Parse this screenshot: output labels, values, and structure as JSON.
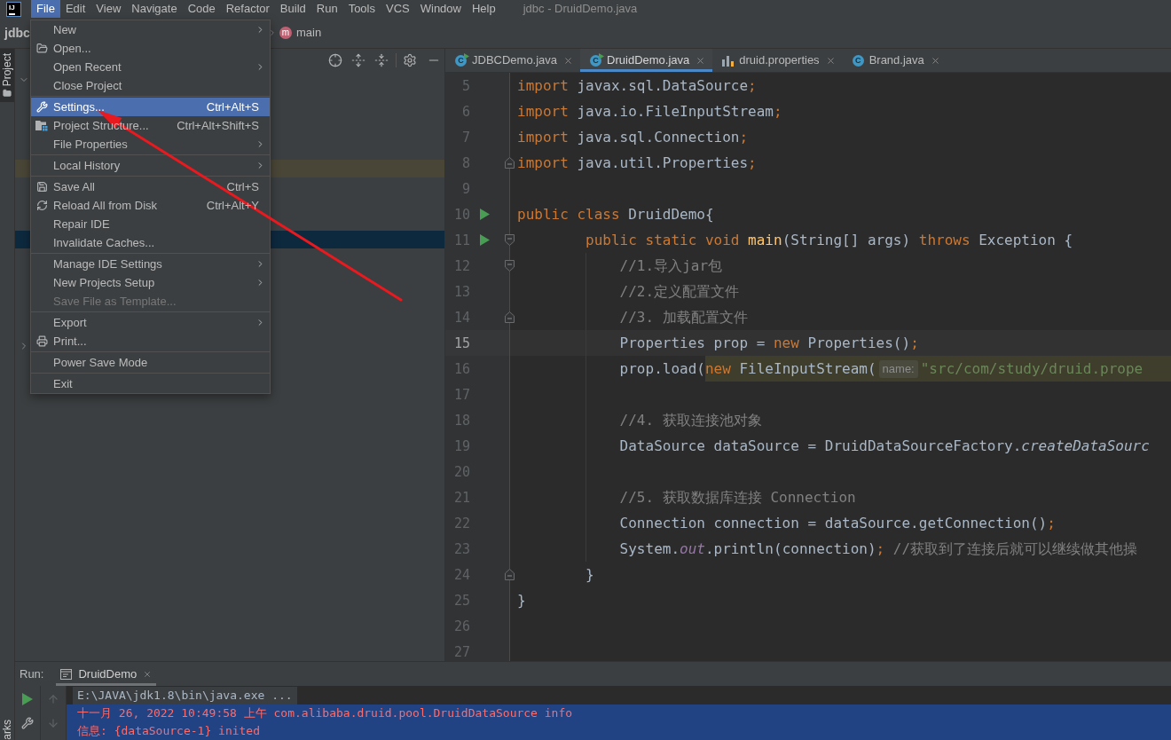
{
  "menubar": {
    "logo": "IJ",
    "items": [
      {
        "label": "File",
        "selected": true
      },
      {
        "label": "Edit",
        "selected": false
      },
      {
        "label": "View",
        "selected": false
      },
      {
        "label": "Navigate",
        "selected": false
      },
      {
        "label": "Code",
        "selected": false
      },
      {
        "label": "Refactor",
        "selected": false
      },
      {
        "label": "Build",
        "selected": false
      },
      {
        "label": "Run",
        "selected": false
      },
      {
        "label": "Tools",
        "selected": false
      },
      {
        "label": "VCS",
        "selected": false
      },
      {
        "label": "Window",
        "selected": false
      },
      {
        "label": "Help",
        "selected": false
      }
    ],
    "title": "jdbc - DruidDemo.java"
  },
  "navbar": {
    "crumbs": [
      {
        "label": "jdbc",
        "kind": "project"
      },
      {
        "label": "main",
        "kind": "method",
        "badge": "m"
      }
    ]
  },
  "tool_stripe": {
    "top": [
      {
        "label": "Project",
        "selected": true
      }
    ],
    "bottom": [
      {
        "label": "arks",
        "selected": false
      }
    ]
  },
  "project_panel": {
    "tree": [
      {
        "expanded": true,
        "selected": false,
        "highlighted": false,
        "children": [
          {
            "selected": false,
            "highlighted": false
          },
          {
            "selected": false,
            "highlighted": false
          },
          {
            "selected": false,
            "highlighted": false
          },
          {
            "selected": false,
            "highlighted": false
          },
          {
            "selected": false,
            "highlighted": true
          },
          {
            "selected": false,
            "highlighted": false
          },
          {
            "selected": false,
            "highlighted": false
          },
          {
            "selected": false,
            "highlighted": false
          },
          {
            "selected": true,
            "highlighted": false
          },
          {
            "selected": false,
            "highlighted": false
          },
          {
            "selected": false,
            "highlighted": false
          },
          {
            "selected": false,
            "highlighted": false
          },
          {
            "selected": false,
            "highlighted": false
          },
          {
            "selected": false,
            "highlighted": false
          }
        ]
      },
      {
        "expanded": false,
        "selected": false,
        "highlighted": false
      }
    ]
  },
  "file_menu": {
    "items": [
      {
        "kind": "item",
        "label": "New",
        "submenu": true,
        "disabled": false,
        "selected": false
      },
      {
        "kind": "item",
        "label": "Open...",
        "submenu": false,
        "disabled": false,
        "selected": false
      },
      {
        "kind": "item",
        "label": "Open Recent",
        "submenu": true,
        "disabled": false,
        "selected": false
      },
      {
        "kind": "item",
        "label": "Close Project",
        "submenu": false,
        "disabled": false,
        "selected": false
      },
      {
        "kind": "separator"
      },
      {
        "kind": "item",
        "label": "Settings...",
        "shortcut": "Ctrl+Alt+S",
        "submenu": false,
        "disabled": false,
        "selected": true
      },
      {
        "kind": "item",
        "label": "Project Structure...",
        "shortcut": "Ctrl+Alt+Shift+S",
        "submenu": false,
        "disabled": false,
        "selected": false
      },
      {
        "kind": "item",
        "label": "File Properties",
        "submenu": true,
        "disabled": false,
        "selected": false
      },
      {
        "kind": "separator"
      },
      {
        "kind": "item",
        "label": "Local History",
        "submenu": true,
        "disabled": false,
        "selected": false
      },
      {
        "kind": "separator"
      },
      {
        "kind": "item",
        "label": "Save All",
        "shortcut": "Ctrl+S",
        "submenu": false,
        "disabled": false,
        "selected": false
      },
      {
        "kind": "item",
        "label": "Reload All from Disk",
        "shortcut": "Ctrl+Alt+Y",
        "submenu": false,
        "disabled": false,
        "selected": false
      },
      {
        "kind": "item",
        "label": "Repair IDE",
        "submenu": false,
        "disabled": false,
        "selected": false
      },
      {
        "kind": "item",
        "label": "Invalidate Caches...",
        "submenu": false,
        "disabled": false,
        "selected": false
      },
      {
        "kind": "separator"
      },
      {
        "kind": "item",
        "label": "Manage IDE Settings",
        "submenu": true,
        "disabled": false,
        "selected": false
      },
      {
        "kind": "item",
        "label": "New Projects Setup",
        "submenu": true,
        "disabled": false,
        "selected": false
      },
      {
        "kind": "item",
        "label": "Save File as Template...",
        "submenu": false,
        "disabled": true,
        "selected": false
      },
      {
        "kind": "separator"
      },
      {
        "kind": "item",
        "label": "Export",
        "submenu": true,
        "disabled": false,
        "selected": false
      },
      {
        "kind": "item",
        "label": "Print...",
        "submenu": false,
        "disabled": false,
        "selected": false
      },
      {
        "kind": "separator"
      },
      {
        "kind": "item",
        "label": "Power Save Mode",
        "submenu": false,
        "disabled": false,
        "selected": false
      },
      {
        "kind": "separator"
      },
      {
        "kind": "item",
        "label": "Exit",
        "submenu": false,
        "disabled": false,
        "selected": false
      }
    ]
  },
  "editor": {
    "tabs": [
      {
        "label": "JDBCDemo.java",
        "kind": "runnable-class",
        "badge": "C",
        "selected": false
      },
      {
        "label": "DruidDemo.java",
        "kind": "runnable-class",
        "badge": "C",
        "selected": true
      },
      {
        "label": "druid.properties",
        "kind": "properties",
        "selected": false
      },
      {
        "label": "Brand.java",
        "kind": "class",
        "badge": "C",
        "selected": false
      }
    ],
    "lines": [
      {
        "number": "5",
        "runnable": false,
        "current": false,
        "tokens": [
          {
            "kind": "keyword",
            "text": "import "
          },
          {
            "kind": "plain",
            "text": "javax.sql.DataSource"
          },
          {
            "kind": "punct",
            "text": ";"
          }
        ]
      },
      {
        "number": "6",
        "runnable": false,
        "current": false,
        "tokens": [
          {
            "kind": "keyword",
            "text": "import "
          },
          {
            "kind": "plain",
            "text": "java.io.FileInputStream"
          },
          {
            "kind": "punct",
            "text": ";"
          }
        ]
      },
      {
        "number": "7",
        "runnable": false,
        "current": false,
        "tokens": [
          {
            "kind": "keyword",
            "text": "import "
          },
          {
            "kind": "plain",
            "text": "java.sql.Connection"
          },
          {
            "kind": "punct",
            "text": ";"
          }
        ]
      },
      {
        "number": "8",
        "runnable": false,
        "current": false,
        "fold_marker": {
          "kind": "end"
        },
        "tokens": [
          {
            "kind": "keyword",
            "text": "import "
          },
          {
            "kind": "plain",
            "text": "java.util.Properties"
          },
          {
            "kind": "punct",
            "text": ";"
          }
        ]
      },
      {
        "number": "9",
        "runnable": false,
        "current": false
      },
      {
        "number": "10",
        "runnable": true,
        "current": false,
        "tokens": [
          {
            "kind": "keyword",
            "text": "public class "
          },
          {
            "kind": "plain",
            "text": "DruidDemo{"
          }
        ],
        "children": [
          {
            "number": "11",
            "runnable": true,
            "current": false,
            "fold_marker": {
              "kind": "start"
            },
            "tokens": [
              {
                "kind": "keyword",
                "text": "public static void "
              },
              {
                "kind": "method",
                "text": "main"
              },
              {
                "kind": "plain",
                "text": "(String[] args) "
              },
              {
                "kind": "keyword",
                "text": "throws "
              },
              {
                "kind": "plain",
                "text": "Exception {"
              }
            ],
            "children": [
              {
                "number": "12",
                "runnable": false,
                "current": false,
                "fold_marker": {
                  "kind": "start"
                },
                "tokens": [
                  {
                    "kind": "comment",
                    "text": "//1.导入jar包"
                  }
                ]
              },
              {
                "number": "13",
                "runnable": false,
                "current": false,
                "tokens": [
                  {
                    "kind": "comment",
                    "text": "//2.定义配置文件"
                  }
                ]
              },
              {
                "number": "14",
                "runnable": false,
                "current": false,
                "fold_marker": {
                  "kind": "end"
                },
                "tokens": [
                  {
                    "kind": "comment",
                    "text": "//3. 加载配置文件"
                  }
                ]
              },
              {
                "number": "15",
                "runnable": false,
                "current": true,
                "tokens": [
                  {
                    "kind": "plain",
                    "text": "Properties prop = "
                  },
                  {
                    "kind": "keyword",
                    "text": "new"
                  },
                  {
                    "kind": "plain",
                    "text": " Properties()"
                  },
                  {
                    "kind": "punct",
                    "text": ";"
                  }
                ]
              },
              {
                "number": "16",
                "runnable": false,
                "current": false,
                "tokens": [
                  {
                    "kind": "plain",
                    "text": "prop.load("
                  }
                ],
                "highlight": {
                  "tokens": [
                    {
                      "kind": "keyword",
                      "text": "new"
                    },
                    {
                      "kind": "plain",
                      "text": " FileInputStream("
                    },
                    {
                      "kind": "hint",
                      "text": "name:"
                    },
                    {
                      "kind": "string",
                      "text": "\"src/com/study/druid.prope"
                    }
                  ]
                }
              },
              {
                "number": "17",
                "runnable": false,
                "current": false
              },
              {
                "number": "18",
                "runnable": false,
                "current": false,
                "tokens": [
                  {
                    "kind": "comment",
                    "text": "//4. 获取连接池对象"
                  }
                ]
              },
              {
                "number": "19",
                "runnable": false,
                "current": false,
                "tokens": [
                  {
                    "kind": "plain",
                    "text": "DataSource dataSource = DruidDataSourceFactory."
                  },
                  {
                    "kind": "static-call",
                    "text": "createDataSourc"
                  }
                ]
              },
              {
                "number": "20",
                "runnable": false,
                "current": false
              },
              {
                "number": "21",
                "runnable": false,
                "current": false,
                "tokens": [
                  {
                    "kind": "comment",
                    "text": "//5. 获取数据库连接 Connection"
                  }
                ]
              },
              {
                "number": "22",
                "runnable": false,
                "current": false,
                "tokens": [
                  {
                    "kind": "plain",
                    "text": "Connection connection = dataSource.getConnection()"
                  },
                  {
                    "kind": "punct",
                    "text": ";"
                  }
                ]
              },
              {
                "number": "23",
                "runnable": false,
                "current": false,
                "tokens": [
                  {
                    "kind": "plain",
                    "text": "System."
                  },
                  {
                    "kind": "field",
                    "text": "out"
                  },
                  {
                    "kind": "plain",
                    "text": ".println(connection)"
                  },
                  {
                    "kind": "punct",
                    "text": ";"
                  },
                  {
                    "kind": "comment",
                    "text": " //获取到了连接后就可以继续做其他操"
                  }
                ]
              }
            ]
          },
          {
            "number": "24",
            "runnable": false,
            "current": false,
            "fold_marker": {
              "kind": "end"
            },
            "tokens": [
              {
                "kind": "plain",
                "text": "}"
              }
            ]
          }
        ]
      },
      {
        "number": "25",
        "runnable": false,
        "current": false,
        "tokens": [
          {
            "kind": "plain",
            "text": "}"
          }
        ]
      },
      {
        "number": "26",
        "runnable": false,
        "current": false
      },
      {
        "number": "27",
        "runnable": false,
        "current": false
      }
    ]
  },
  "run_panel": {
    "label": "Run:",
    "tabs": [
      {
        "label": "DruidDemo",
        "selected": true
      }
    ],
    "nav_buttons": [
      {
        "disabled": true
      },
      {
        "disabled": true
      }
    ],
    "console": [
      {
        "kind": "command",
        "text": "E:\\JAVA\\jdk1.8\\bin\\java.exe ...",
        "selected": false
      },
      {
        "kind": "error",
        "text": "十一月 26, 2022 10:49:58 上午 com.alibaba.druid.pool.DruidDataSource info",
        "selected": true
      },
      {
        "kind": "error",
        "text": "信息: {dataSource-1} inited",
        "selected": true
      }
    ]
  }
}
